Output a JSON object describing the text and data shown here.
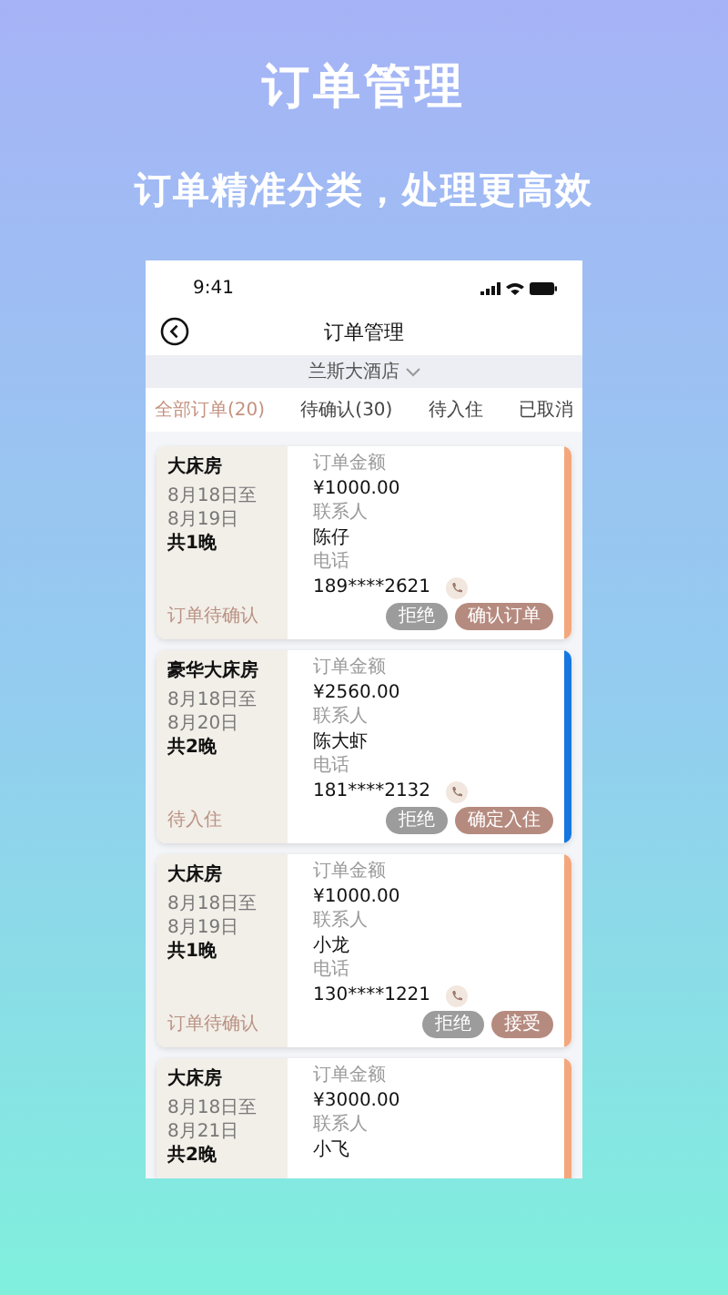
{
  "headline": "订单管理",
  "subheadline": "订单精准分类，处理更高效",
  "status_bar": {
    "time": "9:41"
  },
  "nav": {
    "title": "订单管理"
  },
  "hotel_selector": {
    "label": "兰斯大酒店"
  },
  "tabs": [
    {
      "label": "全部订单(20)",
      "selected": true
    },
    {
      "label": "待确认(30)",
      "selected": false
    },
    {
      "label": "待入住",
      "selected": false
    },
    {
      "label": "已取消",
      "selected": false
    }
  ],
  "orders": [
    {
      "room": "大床房",
      "from": "8月18日至",
      "to": "8月19日",
      "nights": "共1晚",
      "status": "订单待确认",
      "amount_label": "订单金额",
      "amount": "¥1000.00",
      "contact_label": "联系人",
      "contact": "陈仔",
      "phone_label": "电话",
      "phone": "189****2621",
      "buttons": [
        "拒绝",
        "确认订单"
      ],
      "color": "#f4a77c"
    },
    {
      "room": "豪华大床房",
      "from": "8月18日至",
      "to": "8月20日",
      "nights": "共2晚",
      "status": "待入住",
      "amount_label": "订单金额",
      "amount": "¥2560.00",
      "contact_label": "联系人",
      "contact": "陈大虾",
      "phone_label": "电话",
      "phone": "181****2132",
      "buttons": [
        "拒绝",
        "确定入住"
      ],
      "color": "#1677e0"
    },
    {
      "room": "大床房",
      "from": "8月18日至",
      "to": "8月19日",
      "nights": "共1晚",
      "status": "订单待确认",
      "amount_label": "订单金额",
      "amount": "¥1000.00",
      "contact_label": "联系人",
      "contact": "小龙",
      "phone_label": "电话",
      "phone": "130****1221",
      "buttons": [
        "拒绝",
        "接受"
      ],
      "color": "#f4a77c"
    },
    {
      "room": "大床房",
      "from": "8月18日至",
      "to": "8月21日",
      "nights": "共2晚",
      "amount_label": "订单金额",
      "amount": "¥3000.00",
      "contact_label": "联系人",
      "contact": "小飞",
      "color": "#f4a77c"
    }
  ]
}
